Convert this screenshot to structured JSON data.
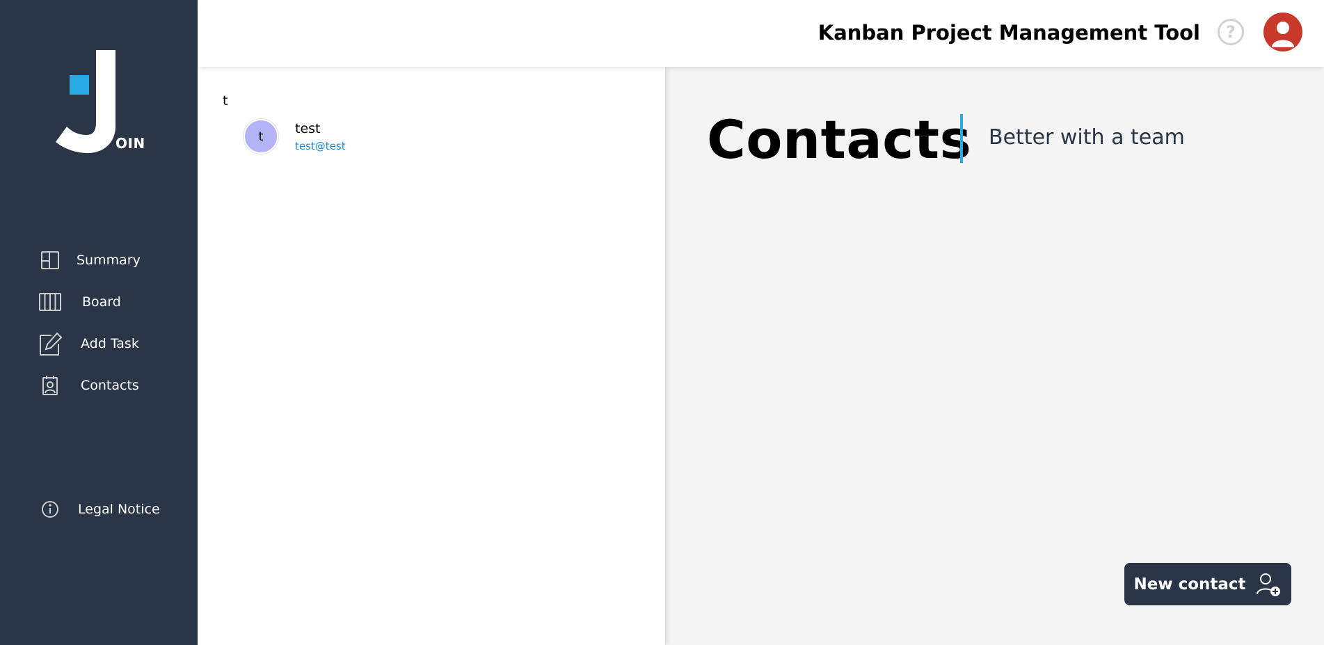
{
  "header": {
    "title": "Kanban Project Management Tool",
    "help_icon": "question-mark-circle-icon",
    "avatar_icon": "user-avatar-icon"
  },
  "sidebar": {
    "logo_text": "OIN",
    "items": [
      {
        "label": "Summary",
        "icon": "summary-icon"
      },
      {
        "label": "Board",
        "icon": "board-icon"
      },
      {
        "label": "Add Task",
        "icon": "edit-icon"
      },
      {
        "label": "Contacts",
        "icon": "contacts-icon"
      }
    ],
    "legal": {
      "label": "Legal Notice",
      "icon": "info-icon"
    }
  },
  "contacts": {
    "groups": [
      {
        "letter": "t",
        "items": [
          {
            "initial": "t",
            "name": "test",
            "email": "test@test"
          }
        ]
      }
    ]
  },
  "main": {
    "title": "Contacts",
    "subtitle": "Better with a team",
    "new_contact_label": "New contact"
  },
  "colors": {
    "sidebar_bg": "#2a3647",
    "accent": "#29abe2",
    "avatar_bg": "#c8392b",
    "contact_circle": "#b3b4f7",
    "email_link": "#1e88e5",
    "main_bg": "#f4f4f4"
  }
}
